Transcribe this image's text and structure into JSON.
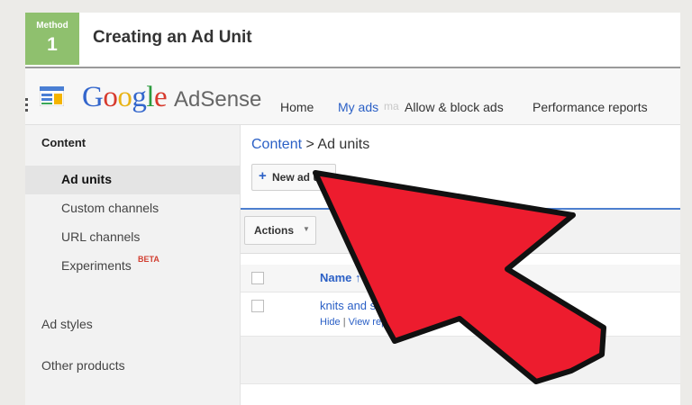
{
  "header": {
    "method_label": "Method",
    "method_number": "1",
    "title": "Creating an Ad Unit"
  },
  "logo": {
    "google_letters": [
      "G",
      "o",
      "o",
      "g",
      "l",
      "e"
    ],
    "product": "AdSense"
  },
  "nav": {
    "tabs": [
      "Home",
      "My ads",
      "Allow & block ads",
      "Performance reports"
    ],
    "active_tab": "My ads",
    "ghost_text": "ma"
  },
  "sidebar": {
    "heading": "Content",
    "items": [
      "Ad units",
      "Custom channels",
      "URL channels",
      "Experiments"
    ],
    "active_item": "Ad units",
    "beta_badge": "BETA",
    "sections": [
      "Ad styles",
      "Other products"
    ]
  },
  "breadcrumb": {
    "root": "Content",
    "separator": ">",
    "current": "Ad units"
  },
  "toolbar": {
    "new_ad_unit_label": "New ad unit",
    "actions_label": "Actions"
  },
  "table": {
    "column_name": "Name",
    "sort_indicator": "↑",
    "rows": [
      {
        "name": "knits and stitches",
        "links": [
          "Hide",
          "View report"
        ],
        "link_separator": "|"
      }
    ]
  },
  "colors": {
    "accent_blue": "#2b60c6",
    "method_green": "#8fc06e",
    "arrow_red": "#ed1c2e",
    "beta_red": "#d23f31"
  },
  "icons": {
    "app_icon": "adsense-app-icon",
    "pointer": "red-arrow-pointer"
  }
}
